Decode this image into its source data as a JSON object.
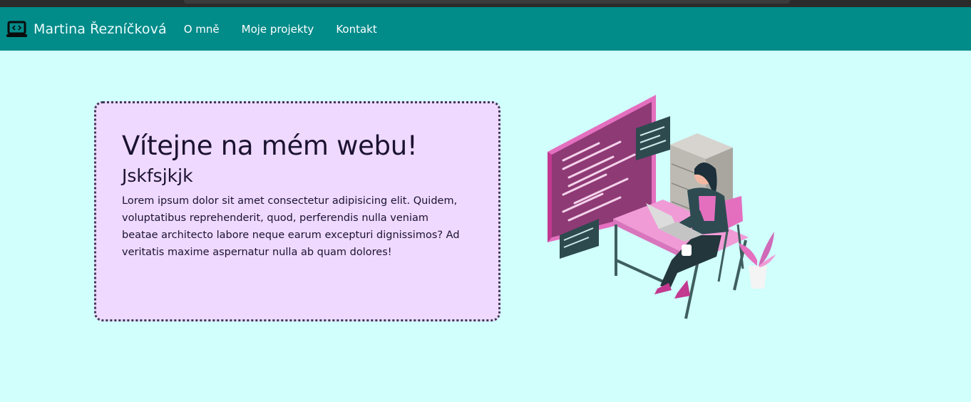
{
  "brand": {
    "name": "Martina Řezníčková",
    "icon": "laptop-code-icon"
  },
  "nav": {
    "items": [
      "O mně",
      "Moje projekty",
      "Kontakt"
    ]
  },
  "hero": {
    "title": "Vítejne na mém webu!",
    "subtitle": "Jskfsjkjk",
    "text": "Lorem ipsum dolor sit amet consectetur adipisicing elit. Quidem, voluptatibus reprehenderit, quod, perferendis nulla veniam beatae architecto labore neque earum excepturi dignissimos? Ad veritatis maxime aspernatur nulla ab quam dolores!"
  },
  "illustration": {
    "icon": "developer-at-desk-illustration"
  },
  "colors": {
    "navbar": "#018b89",
    "page_background": "#d0fffc",
    "card_background": "#efd9ff",
    "card_border": "#3c3b55",
    "accent_magenta": "#c2398f"
  }
}
